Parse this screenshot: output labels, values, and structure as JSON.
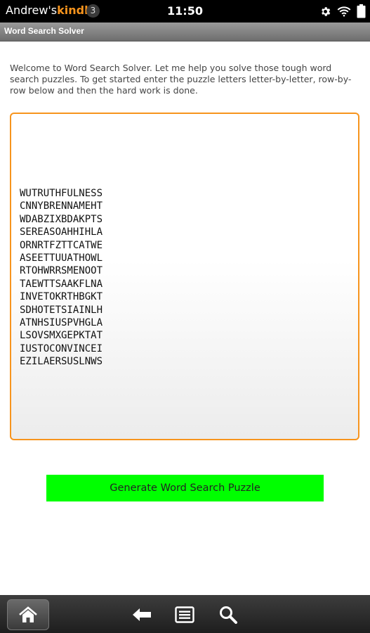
{
  "status_bar": {
    "owner": "Andrew's",
    "device": "kindle",
    "notification_count": "3",
    "time": "11:50",
    "icons": [
      "gear-icon",
      "wifi-icon",
      "battery-icon"
    ]
  },
  "app": {
    "title": "Word Search Solver"
  },
  "main": {
    "welcome_text": "Welcome to Word Search Solver. Let me help you solve those tough word search puzzles. To get started enter the puzzle letters letter-by-letter, row-by-row below and then the hard work is done.",
    "puzzle_rows": [
      "WUTRUTHFULNESS",
      "CNNYBRENNAMEHT",
      "WDABZIXBDAKPTS",
      "SEREASOAHHIHLA",
      "ORNRTFZTTCATWE",
      "ASEETTUUATHOWL",
      "RTOHWRRSMENOOT",
      "TAEWTTSAAKFLNA",
      "INVETOKRTHBGKT",
      "SDHOTETSIAINLH",
      "ATNHSIUSPVHGLA",
      "LSOVSMXGEPKTAT",
      "IUSTOCONVINCEI",
      "EZILAERSUSLNWS"
    ],
    "generate_button_label": "Generate Word Search Puzzle"
  },
  "nav_bar": {
    "icons": [
      "home-icon",
      "back-icon",
      "menu-icon",
      "search-icon"
    ]
  },
  "colors": {
    "accent": "#f7941d",
    "button": "#00ff00"
  }
}
